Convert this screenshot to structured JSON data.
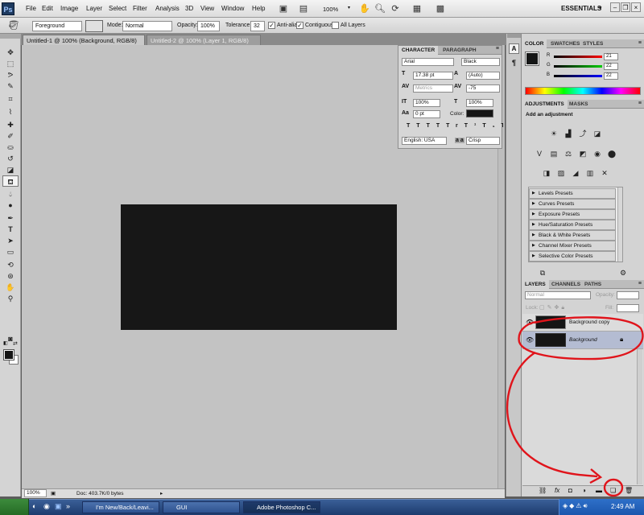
{
  "app": {
    "logo": "Ps"
  },
  "menu": [
    "File",
    "Edit",
    "Image",
    "Layer",
    "Select",
    "Filter",
    "Analysis",
    "3D",
    "View",
    "Window",
    "Help"
  ],
  "menubar": {
    "zoom": "100%",
    "workspace": "ESSENTIALS"
  },
  "options": {
    "fill_source": "Foreground",
    "mode_label": "Mode:",
    "mode_value": "Normal",
    "opacity_label": "Opacity:",
    "opacity_value": "100%",
    "tolerance_label": "Tolerance:",
    "tolerance_value": "32",
    "anti_alias": "Anti-alias",
    "contiguous": "Contiguous",
    "all_layers": "All Layers"
  },
  "tabs": [
    {
      "label": "Untitled-1 @ 100% (Background, RGB/8) *",
      "close": "×"
    },
    {
      "label": "Untitled-2 @ 100% (Layer 1, RGB/8) *",
      "close": "×"
    }
  ],
  "status": {
    "zoom": "100%",
    "doc": "Doc: 403.7K/0 bytes"
  },
  "character": {
    "tab1": "CHARACTER",
    "tab2": "PARAGRAPH",
    "font": "Arial",
    "style": "Black",
    "size": "17.38 pt",
    "leading": "(Auto)",
    "kerning": "Metrics",
    "tracking": "-75",
    "vscale": "100%",
    "hscale": "100%",
    "baseline": "0 pt",
    "color_label": "Color:",
    "styles": [
      "T",
      "T",
      "TT",
      "Tr",
      "T¹",
      "T₁",
      "T",
      "T"
    ],
    "language": "English: USA",
    "aa_label": "a a",
    "antialias": "Crisp"
  },
  "color_panel": {
    "tabs": [
      "COLOR",
      "SWATCHES",
      "STYLES"
    ],
    "r_label": "R",
    "g_label": "G",
    "b_label": "B",
    "r": "21",
    "g": "22",
    "b": "22",
    "fg_color": "#151616"
  },
  "adjustments": {
    "tabs": [
      "ADJUSTMENTS",
      "MASKS"
    ],
    "title": "Add an adjustment",
    "presets": [
      "Levels Presets",
      "Curves Presets",
      "Exposure Presets",
      "Hue/Saturation Presets",
      "Black & White Presets",
      "Channel Mixer Presets",
      "Selective Color Presets"
    ]
  },
  "layers": {
    "tabs": [
      "LAYERS",
      "CHANNELS",
      "PATHS"
    ],
    "blend_mode": "Normal",
    "opacity_label": "Opacity:",
    "lock_label": "Lock:",
    "fill_label": "Fill:",
    "items": [
      {
        "name": "Background copy"
      },
      {
        "name": "Background"
      }
    ]
  },
  "taskbar": {
    "buttons": [
      "I'm New/Back/Leavi...",
      "GUI",
      "Adobe Photoshop C..."
    ],
    "clock": "2:49 AM"
  },
  "colors": {
    "annotation": "#e0141b",
    "canvas": "#171717",
    "selection": "#b4bcd2"
  }
}
